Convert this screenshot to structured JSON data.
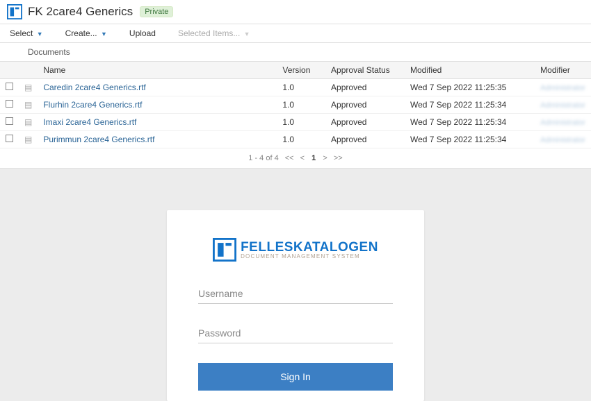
{
  "header": {
    "title": "FK 2care4 Generics",
    "badge": "Private"
  },
  "toolbar": {
    "select": "Select",
    "create": "Create...",
    "upload": "Upload",
    "selected_items": "Selected Items..."
  },
  "breadcrumb": "Documents",
  "table": {
    "headers": {
      "name": "Name",
      "version": "Version",
      "approval_status": "Approval Status",
      "modified": "Modified",
      "modifier": "Modifier"
    },
    "rows": [
      {
        "name": "Caredin 2care4 Generics.rtf",
        "version": "1.0",
        "status": "Approved",
        "modified": "Wed 7 Sep 2022 11:25:35",
        "modifier": "Administrator"
      },
      {
        "name": "Flurhin 2care4 Generics.rtf",
        "version": "1.0",
        "status": "Approved",
        "modified": "Wed 7 Sep 2022 11:25:34",
        "modifier": "Administrator"
      },
      {
        "name": "Imaxi 2care4 Generics.rtf",
        "version": "1.0",
        "status": "Approved",
        "modified": "Wed 7 Sep 2022 11:25:34",
        "modifier": "Administrator"
      },
      {
        "name": "Purimmun 2care4 Generics.rtf",
        "version": "1.0",
        "status": "Approved",
        "modified": "Wed 7 Sep 2022 11:25:34",
        "modifier": "Administrator"
      }
    ]
  },
  "pagination": {
    "range": "1 - 4 of 4",
    "first": "<<",
    "prev": "<",
    "current": "1",
    "next": ">",
    "last": ">>"
  },
  "login": {
    "brand": "FELLESKATALOGEN",
    "sub": "DOCUMENT MANAGEMENT SYSTEM",
    "username_placeholder": "Username",
    "password_placeholder": "Password",
    "signin": "Sign In"
  }
}
